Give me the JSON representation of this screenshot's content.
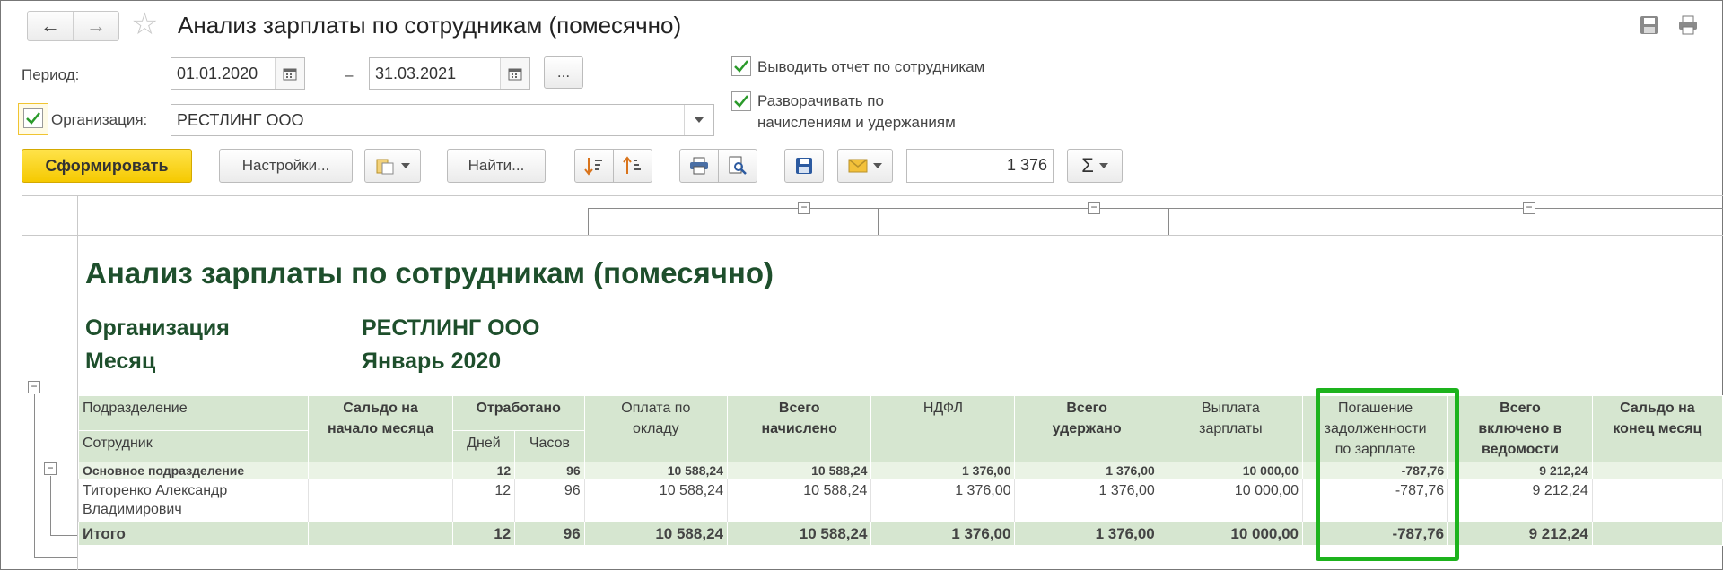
{
  "window": {
    "title": "Анализ зарплаты по сотрудникам (помесячно)",
    "back_icon": "←",
    "forward_icon": "→",
    "star_icon": "☆"
  },
  "form": {
    "period_label": "Период:",
    "date_from": "01.01.2020",
    "date_dash": "–",
    "date_to": "31.03.2021",
    "ellipsis_label": "...",
    "org_label": "Организация:",
    "org_value": "РЕСТЛИНГ ООО",
    "opt_employees": "Выводить отчет по сотрудникам",
    "opt_expand_line1": "Разворачивать по",
    "opt_expand_line2": "начислениям и удержаниям"
  },
  "toolbar": {
    "generate_label": "Сформировать",
    "settings_label": "Настройки...",
    "find_label": "Найти...",
    "sum_value": "1 376",
    "sum_icon": "Σ"
  },
  "report": {
    "title": "Анализ зарплаты по сотрудникам (помесячно)",
    "org_key": "Организация",
    "org_val": "РЕСТЛИНГ ООО",
    "month_key": "Месяц",
    "month_val": "Январь 2020",
    "headers": {
      "division": "Подразделение",
      "employee": "Сотрудник",
      "opening_1": "Сальдо на",
      "opening_2": "начало месяца",
      "worked": "Отработано",
      "days": "Дней",
      "hours": "Часов",
      "salary_1": "Оплата по",
      "salary_2": "окладу",
      "accrued_1": "Всего",
      "accrued_2": "начислено",
      "ndfl": "НДФЛ",
      "withheld_1": "Всего",
      "withheld_2": "удержано",
      "payout_1": "Выплата",
      "payout_2": "зарплаты",
      "debt_1": "Погашение",
      "debt_2": "задолженности",
      "debt_3": "по зарплате",
      "included_1": "Всего",
      "included_2": "включено в",
      "included_3": "ведомости",
      "closing_1": "Сальдо на",
      "closing_2": "конец месяц"
    },
    "group_row": {
      "name": "Основное подразделение",
      "days": "12",
      "hours": "96",
      "salary": "10 588,24",
      "accrued": "10 588,24",
      "ndfl": "1 376,00",
      "withheld": "1 376,00",
      "payout": "10 000,00",
      "debt": "-787,76",
      "included": "9 212,24"
    },
    "employee_row": {
      "name_1": "Титоренко Александр",
      "name_2": "Владимирович",
      "days": "12",
      "hours": "96",
      "salary": "10 588,24",
      "accrued": "10 588,24",
      "ndfl": "1 376,00",
      "withheld": "1 376,00",
      "payout": "10 000,00",
      "debt": "-787,76",
      "included": "9 212,24"
    },
    "total_row": {
      "name": "Итого",
      "days": "12",
      "hours": "96",
      "salary": "10 588,24",
      "accrued": "10 588,24",
      "ndfl": "1 376,00",
      "withheld": "1 376,00",
      "payout": "10 000,00",
      "debt": "-787,76",
      "included": "9 212,24"
    },
    "collapse_glyph": "−"
  },
  "colors": {
    "highlight": "#1db31d",
    "header_fill": "#d6e6d0",
    "title_text": "#1e4f2c",
    "primary_button": "#f5c900"
  }
}
